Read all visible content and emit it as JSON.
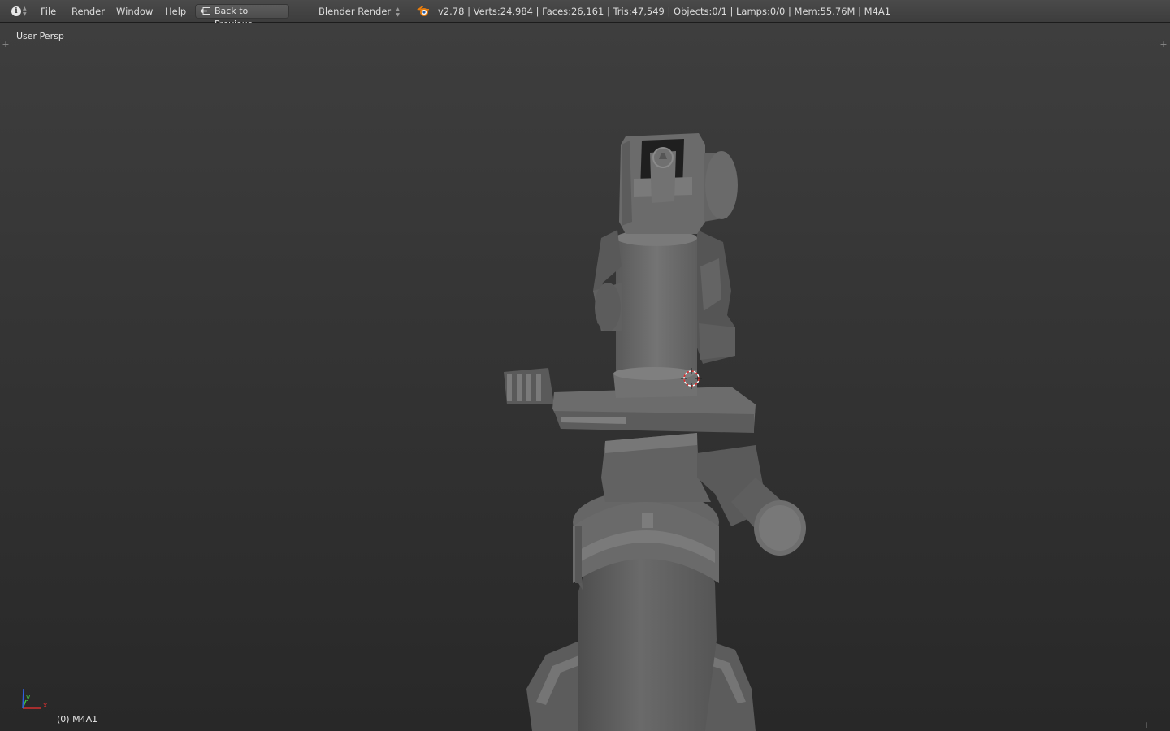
{
  "header": {
    "editor_type_icon": "info-icon",
    "menus": [
      "File",
      "Render",
      "Window",
      "Help"
    ],
    "back_button_label": "Back to Previous",
    "render_engine": "Blender Render",
    "stats": "v2.78 | Verts:24,984 | Faces:26,161 | Tris:47,549 | Objects:0/1 | Lamps:0/0 | Mem:55.76M | M4A1"
  },
  "viewport": {
    "view_label": "User Persp",
    "object_label": "(0) M4A1",
    "axis": {
      "x": "x",
      "y": "y"
    }
  },
  "colors": {
    "header_bg": "#424242",
    "viewport_top": "#3e3e3e",
    "viewport_bottom": "#282828",
    "model_gray": "#6e6e6e",
    "axis_x": "#d03030",
    "axis_y": "#40c040",
    "axis_z": "#3060e0",
    "cursor_red": "#e03030"
  }
}
